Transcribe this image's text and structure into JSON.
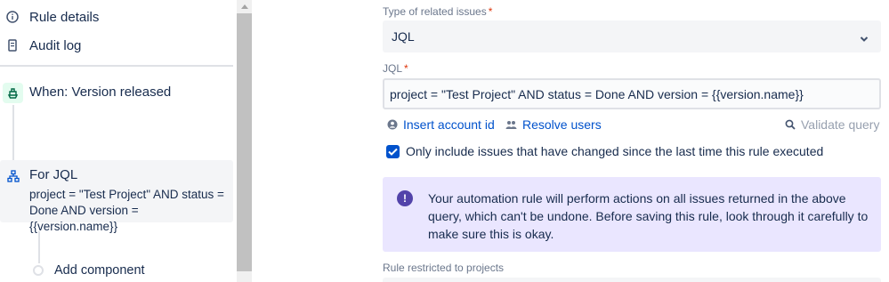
{
  "sidebar": {
    "rule_details": "Rule details",
    "audit_log": "Audit log",
    "trigger": "When: Version released",
    "branch_title": "For JQL",
    "branch_query": "project = \"Test Project\" AND status = Done AND version = {{version.name}}",
    "add_component": "Add component"
  },
  "form": {
    "type_label": "Type of related issues",
    "type_value": "JQL",
    "jql_label": "JQL",
    "jql_value": "project = \"Test Project\" AND status = Done AND version = {{version.name}}",
    "insert_account": "Insert account id",
    "resolve_users": "Resolve users",
    "validate_query": "Validate query",
    "only_changed": "Only include issues that have changed since the last time this rule executed",
    "only_changed_checked": true,
    "warning": "Your automation rule will perform actions on all issues returned in the above query, which can't be undone. Before saving this rule, look through it carefully to make sure this is okay.",
    "restricted_label": "Rule restricted to projects",
    "required_mark": "*"
  },
  "colors": {
    "link": "#0052cc",
    "warning_bg": "#eae6ff",
    "warning_icon": "#5243aa",
    "trigger_badge": "#e3fcef",
    "required": "#de350b"
  }
}
